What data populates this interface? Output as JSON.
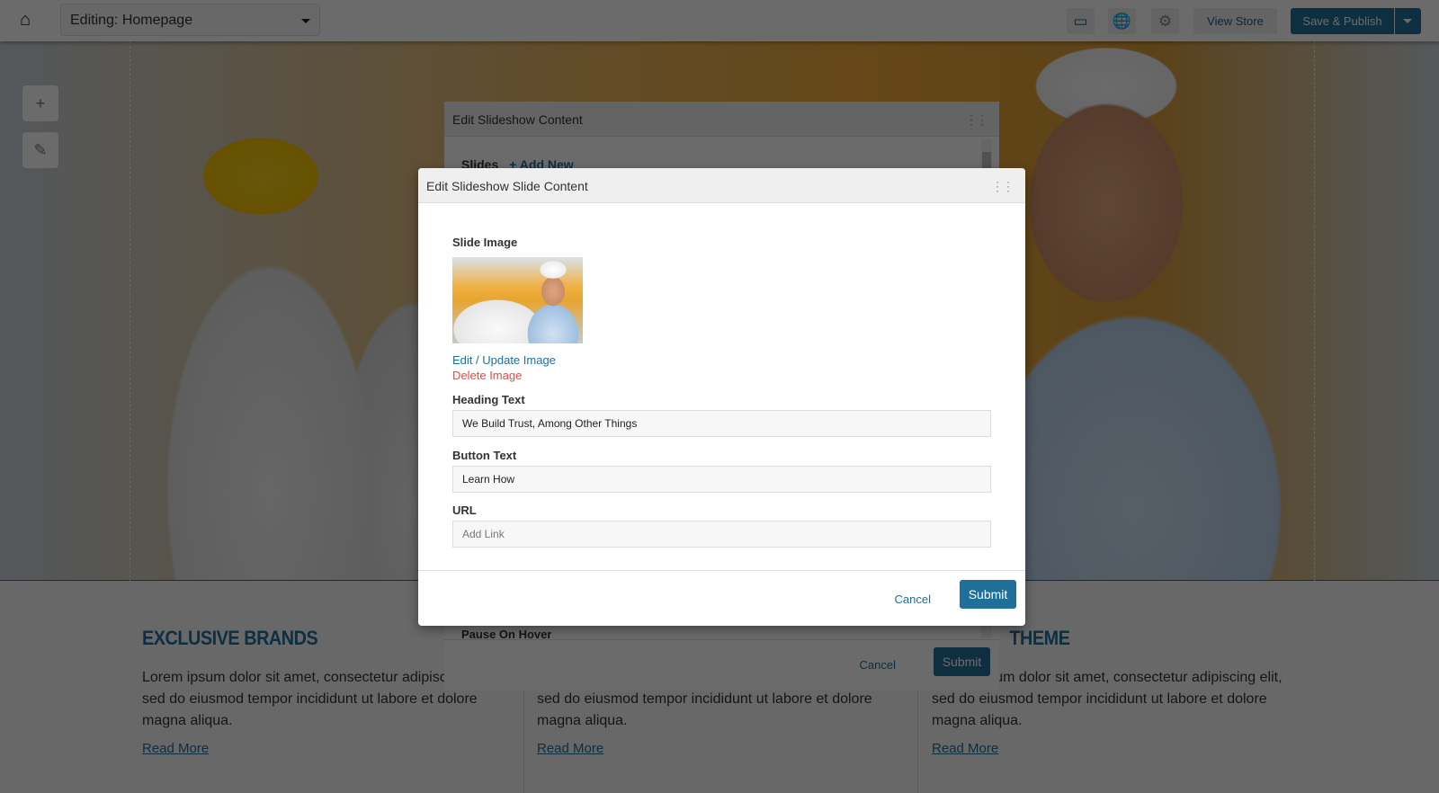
{
  "topbar": {
    "page_selector": "Editing: Homepage",
    "view_store": "View Store",
    "save_publish": "Save & Publish",
    "accent_color": "#1e6f99"
  },
  "page": {
    "columns": [
      {
        "heading": "EXCLUSIVE BRANDS",
        "body": "Lorem ipsum dolor sit amet, consectetur adipiscing elit, sed do eiusmod tempor incididunt ut labore et dolore magna aliqua.",
        "link": "Read More"
      },
      {
        "heading": "",
        "body": "Lorem ipsum dolor sit amet, consectetur adipiscing elit, sed do eiusmod tempor incididunt ut labore et dolore magna aliqua.",
        "link": "Read More"
      },
      {
        "heading": "THEME",
        "body": "Lorem ipsum dolor sit amet, consectetur adipiscing elit, sed do eiusmod tempor incididunt ut labore et dolore magna aliqua.",
        "link": "Read More"
      }
    ]
  },
  "slideshow_panel": {
    "title": "Edit Slideshow Content",
    "slides_label": "Slides",
    "add_new": "+ Add New",
    "pause_on_hover": "Pause On Hover",
    "cancel": "Cancel",
    "submit": "Submit"
  },
  "slide_dialog": {
    "title": "Edit Slideshow Slide Content",
    "slide_image_label": "Slide Image",
    "edit_image": "Edit / Update Image",
    "delete_image": "Delete Image",
    "heading_label": "Heading Text",
    "heading_value": "We Build Trust, Among Other Things",
    "button_label": "Button Text",
    "button_value": "Learn How",
    "url_label": "URL",
    "url_placeholder": "Add Link",
    "cancel": "Cancel",
    "submit": "Submit"
  }
}
